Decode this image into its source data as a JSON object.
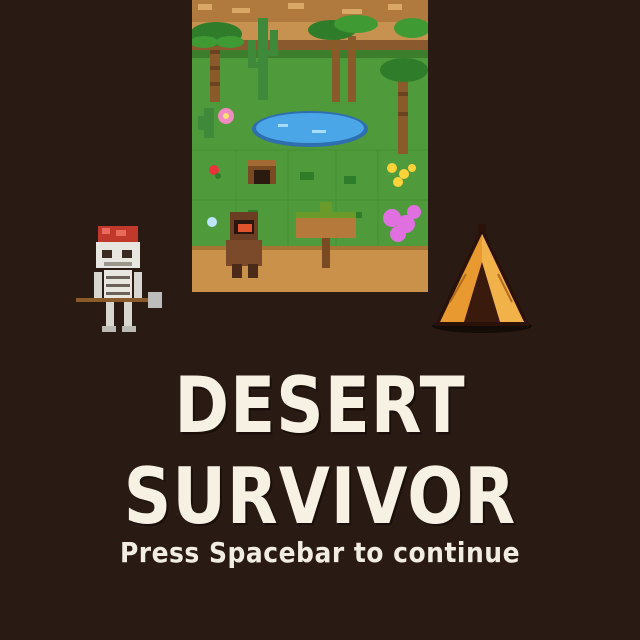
{
  "game": {
    "title": "DESERT SURVIVOR",
    "prompt": "Press Spacebar to continue"
  },
  "colors": {
    "background": "#2a1a14",
    "title_text": "#f7f1e4",
    "prompt_text": "#f2ede3",
    "grass": "#4f9a3a",
    "sand": "#c9914a",
    "water": "#4aa6e6",
    "tent": "#e89a30"
  },
  "sprites": [
    "oasis-map",
    "skeleton-warrior",
    "hooded-wanderer",
    "tent"
  ]
}
